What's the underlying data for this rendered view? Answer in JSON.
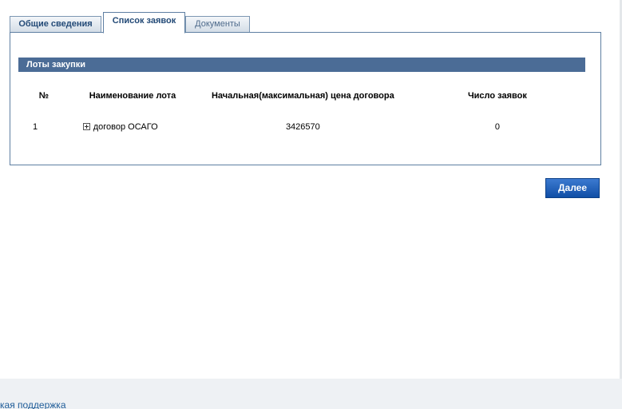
{
  "tabs": [
    {
      "label": "Общие сведения"
    },
    {
      "label": "Список заявок"
    },
    {
      "label": "Документы"
    }
  ],
  "section": {
    "title": "Лоты закупки"
  },
  "table": {
    "headers": {
      "num": "№",
      "name": "Наименование лота",
      "price": "Начальная(максимальная) цена договора",
      "count": "Число заявок"
    },
    "rows": [
      {
        "num": "1",
        "name": "договор ОСАГО",
        "price": "3426570",
        "count": "0"
      }
    ]
  },
  "buttons": {
    "next_label": "Далее"
  },
  "footer": {
    "support_link": "кая поддержка"
  },
  "colors": {
    "accent": "#4b6c96",
    "button": "#1f5bb5",
    "border": "#5e7fa2"
  }
}
